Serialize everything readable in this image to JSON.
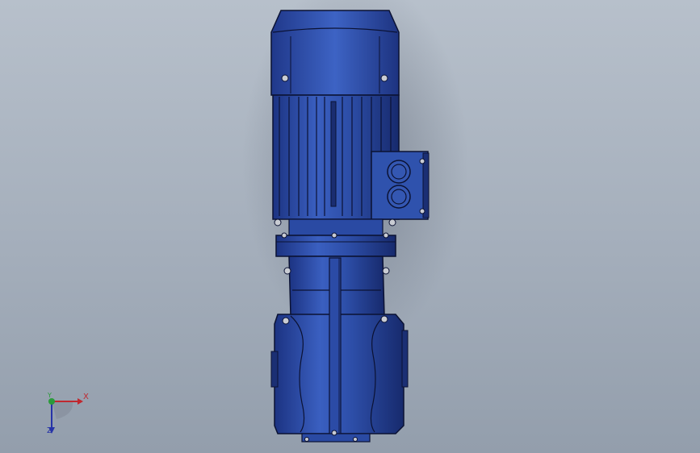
{
  "viewport": {
    "background_top": "#b7c0cb",
    "background_bottom": "#939eac",
    "model": "gear motor",
    "view": "top"
  },
  "colors": {
    "body_blue": "#2c4ea6",
    "body_dark": "#1b2f74",
    "outline": "#0b1233",
    "x_axis": "#c0282f",
    "y_axis": "#2b9b3a",
    "z_axis": "#2633a8"
  },
  "triad": {
    "x_label": "X",
    "y_label": "Y",
    "z_label": "Z"
  }
}
